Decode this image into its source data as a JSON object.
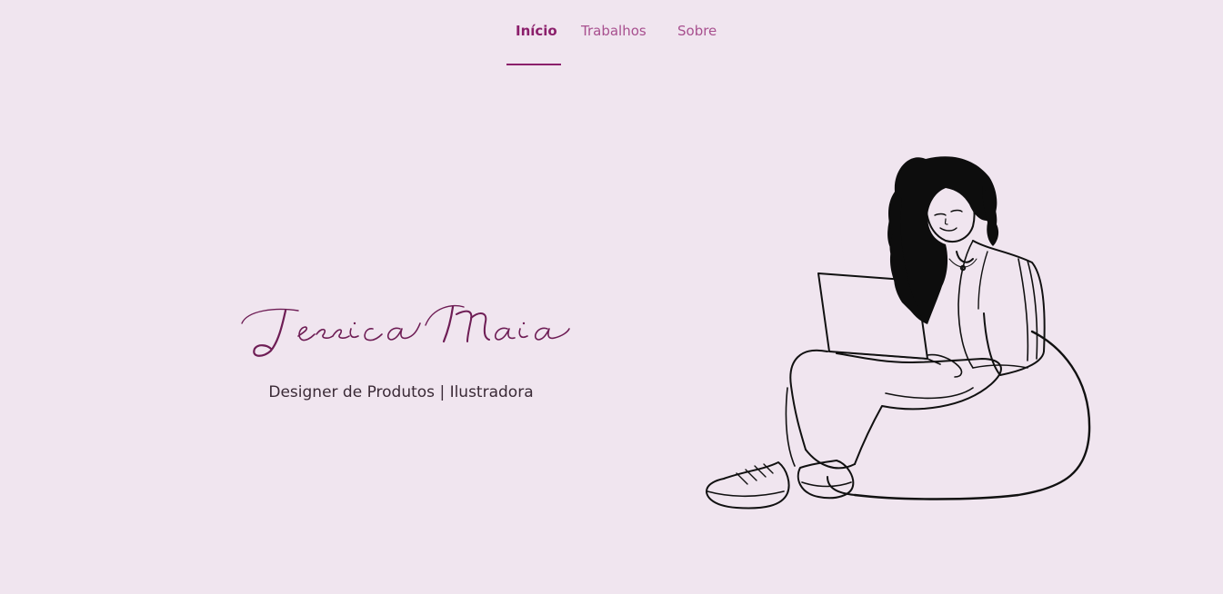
{
  "nav": {
    "items": [
      {
        "label": "Início",
        "active": true
      },
      {
        "label": "Trabalhos",
        "active": false
      },
      {
        "label": "Sobre",
        "active": false
      }
    ]
  },
  "hero": {
    "name": "Jessica Maia",
    "subtitle": "Designer de Produtos | Ilustradora"
  },
  "colors": {
    "background": "#f0e5ef",
    "accent": "#8b1f6b",
    "nav_inactive": "#a8508f",
    "name": "#6e1d55",
    "text": "#3a2a36"
  },
  "icons": {
    "illustration": "woman-with-laptop-on-beanbag-illustration"
  }
}
